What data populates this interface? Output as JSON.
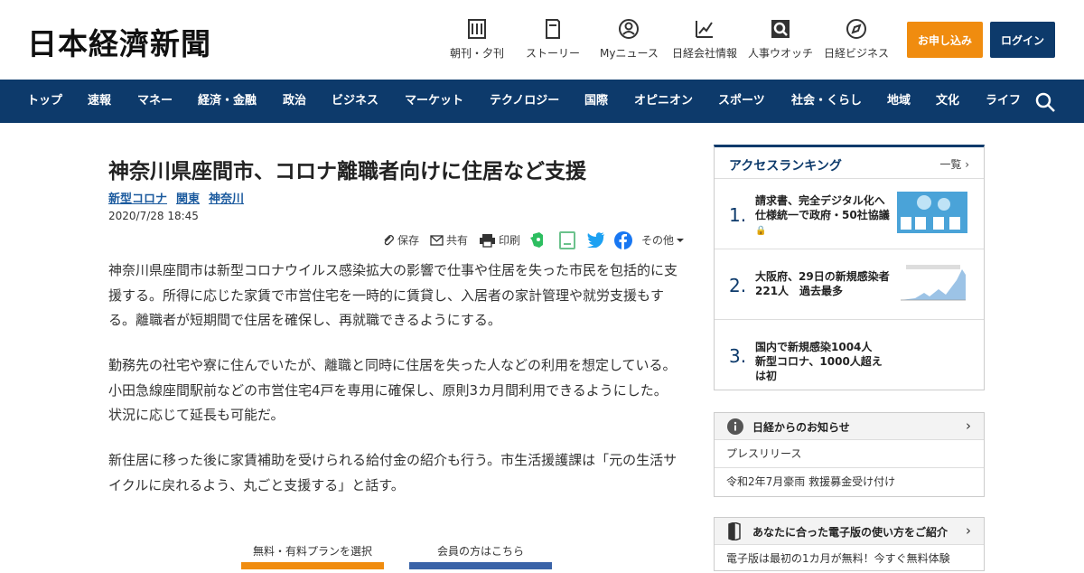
{
  "header": {
    "logo": "日本経濟新聞",
    "nav": [
      {
        "label": "朝刊・夕刊",
        "icon": "newspaper-icon"
      },
      {
        "label": "ストーリー",
        "icon": "book-icon"
      },
      {
        "label": "Myニュース",
        "icon": "user-icon"
      },
      {
        "label": "日経会社情報",
        "icon": "chart-icon"
      },
      {
        "label": "人事ウオッチ",
        "icon": "magnifier-icon"
      },
      {
        "label": "日経ビジネス",
        "icon": "compass-icon"
      }
    ],
    "apply_label": "お申し込み",
    "login_label": "ログイン",
    "colors": {
      "navy": "#0d3a6b",
      "orange": "#f08c0f"
    }
  },
  "navbar": {
    "items": [
      "トップ",
      "速報",
      "マネー",
      "経済・金融",
      "政治",
      "ビジネス",
      "マーケット",
      "テクノロジー",
      "国際",
      "オピニオン",
      "スポーツ",
      "社会・くらし",
      "地域",
      "文化",
      "ライフ"
    ]
  },
  "article": {
    "title": "神奈川県座間市、コロナ離職者向けに住居など支援",
    "tags": [
      "新型コロナ",
      "関東",
      "神奈川"
    ],
    "date": "2020/7/28 18:45",
    "share": {
      "save": "保存",
      "share": "共有",
      "print": "印刷",
      "more": "その他"
    },
    "paragraphs": [
      "神奈川県座間市は新型コロナウイルス感染拡大の影響で仕事や住居を失った市民を包括的に支援する。所得に応じた家賃で市営住宅を一時的に賃貸し、入居者の家計管理や就労支援もする。離職者が短期間で住居を確保し、再就職できるようにする。",
      "勤務先の社宅や寮に住んでいたが、離職と同時に住居を失った人などの利用を想定している。小田急線座間駅前などの市営住宅4戸を専用に確保し、原則3カ月間利用できるようにした。状況に応じて延長も可能だ。",
      "新住居に移った後に家賃補助を受けられる給付金の紹介も行う。市生活援護課は「元の生活サイクルに戻れるよう、丸ごと支援する」と話す。"
    ],
    "cta": {
      "plan_label": "無料・有料プランを選択",
      "member_label": "会員の方はこちら"
    }
  },
  "ranking": {
    "heading": "アクセスランキング",
    "more": "一覧",
    "items": [
      {
        "num": "1.",
        "text": "請求書、完全デジタル化へ　仕様統一で政府・50社協議"
      },
      {
        "num": "2.",
        "text": "大阪府、29日の新規感染者221人　過去最多"
      },
      {
        "num": "3.",
        "text": "国内で新規感染1004人　新型コロナ、1000人超えは初"
      }
    ]
  },
  "notices": {
    "heading": "日経からのお知らせ",
    "links": [
      "プレスリリース",
      "令和2年7月豪雨 救援募金受け付け"
    ]
  },
  "guide": {
    "heading": "あなたに合った電子版の使い方をご紹介",
    "links": [
      "電子版は最初の1カ月が無料！今すぐ無料体験"
    ]
  }
}
